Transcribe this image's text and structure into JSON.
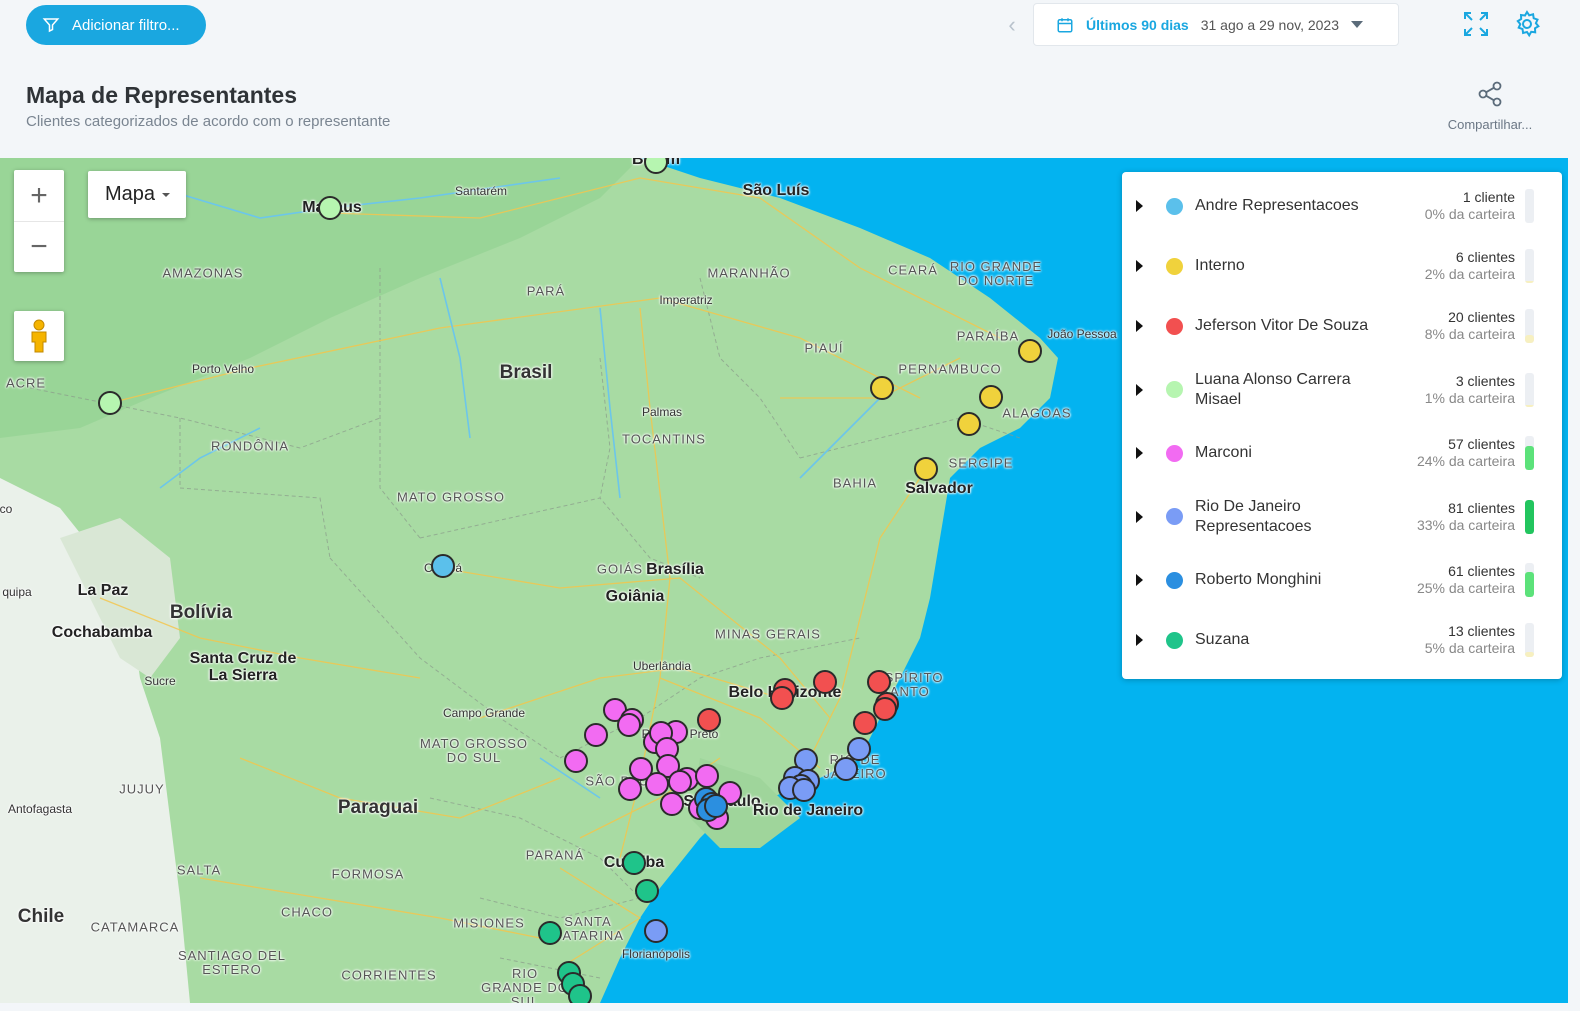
{
  "toolbar": {
    "filter_label": "Adicionar filtro...",
    "period_label": "Últimos 90 dias",
    "range_label": "31 ago a 29 nov, 2023",
    "share_label": "Compartilhar..."
  },
  "header": {
    "title": "Mapa de Representantes",
    "subtitle": "Clientes categorizados de acordo com o representante"
  },
  "map": {
    "type_label": "Mapa",
    "zoom_in": "+",
    "zoom_out": "−",
    "labels": {
      "country_brasil": "Brasil",
      "country_bolivia": "Bolívia",
      "country_paraguai": "Paraguai",
      "country_chile": "Chile",
      "amazonas": "AMAZONAS",
      "para": "PARÁ",
      "maranhao": "MARANHÃO",
      "ceara": "CEARÁ",
      "rgn": "RIO GRANDE DO NORTE",
      "paraiba": "PARAÍBA",
      "pernambuco": "PERNAMBUCO",
      "alagoas": "ALAGOAS",
      "sergipe": "SERGIPE",
      "piaui": "PIAUÍ",
      "bahia": "BAHIA",
      "tocantins": "TOCANTINS",
      "acre": "ACRE",
      "rondonia": "RONDÔNIA",
      "mato_grosso": "MATO GROSSO",
      "goias": "GOIÁS",
      "minas": "MINAS GERAIS",
      "es": "ESPÍRITO SANTO",
      "ms": "MATO GROSSO DO SUL",
      "sp": "SÃO PAULO",
      "rj": "RIO DE JANEIRO",
      "parana": "PARANÁ",
      "sc": "SANTA CATARINA",
      "rs": "RIO GRANDE DO SUL",
      "jujuy": "JUJUY",
      "salta": "SALTA",
      "formosa": "FORMOSA",
      "chaco": "CHACO",
      "catamarca": "CATAMARCA",
      "santiago": "SANTIAGO DEL ESTERO",
      "misiones": "MISIONES",
      "corrientes": "CORRIENTES",
      "belem": "Belém",
      "manaus": "Manaus",
      "santarem": "Santarém",
      "sao_luis": "São Luís",
      "imperatriz": "Imperatriz",
      "porto_velho": "Porto Velho",
      "palmas": "Palmas",
      "joao_pessoa": "João Pessoa",
      "salvador": "Salvador",
      "cuiaba": "Cuiabá",
      "brasilia": "Brasília",
      "goiania": "Goiânia",
      "uberlandia": "Uberlândia",
      "bh": "Belo Horizonte",
      "campo_grande": "Campo Grande",
      "ribeirao": "Ribeirão Preto",
      "sao_paulo": "São Paulo",
      "rio": "Rio de Janeiro",
      "curitiba": "Curitiba",
      "florianopolis": "Florianópolis",
      "la_paz": "La Paz",
      "cochabamba": "Cochabamba",
      "santa_cruz": "Santa Cruz de La Sierra",
      "sucre": "Sucre",
      "antofagasta": "Antofagasta",
      "iquipa": "quipa",
      "co": "co"
    }
  },
  "legend": [
    {
      "name": "Andre Representacoes",
      "count": "1 cliente",
      "share": "0% da carteira",
      "color": "#5bc0eb",
      "fill": 0.0
    },
    {
      "name": "Interno",
      "count": "6 clientes",
      "share": "2% da carteira",
      "color": "#f0d23c",
      "fill": 0.02
    },
    {
      "name": "Jeferson Vitor De Souza",
      "count": "20 clientes",
      "share": "8% da carteira",
      "color": "#f25050",
      "fill": 0.08
    },
    {
      "name": "Luana Alonso Carrera Misael",
      "count": "3 clientes",
      "share": "1% da carteira",
      "color": "#b6f5b0",
      "fill": 0.01
    },
    {
      "name": "Marconi",
      "count": "57 clientes",
      "share": "24% da carteira",
      "color": "#f26bf2",
      "fill": 0.24
    },
    {
      "name": "Rio De Janeiro Representacoes",
      "count": "81 clientes",
      "share": "33% da carteira",
      "color": "#7a9cf5",
      "fill": 0.33
    },
    {
      "name": "Roberto Monghini",
      "count": "61 clientes",
      "share": "25% da carteira",
      "color": "#2b8fe0",
      "fill": 0.25
    },
    {
      "name": "Suzana",
      "count": "13 clientes",
      "share": "5% da carteira",
      "color": "#1fc48a",
      "fill": 0.05
    }
  ]
}
